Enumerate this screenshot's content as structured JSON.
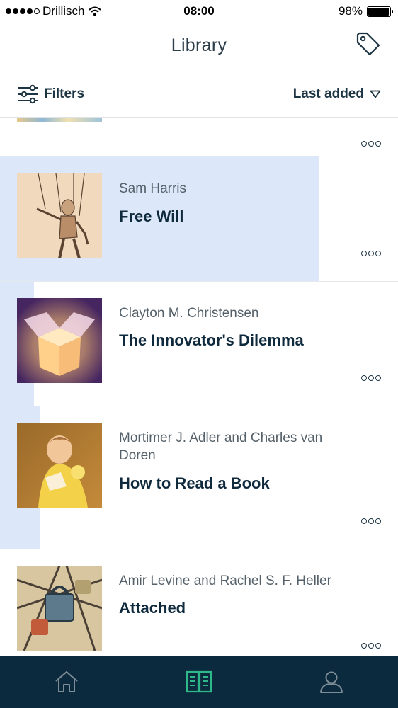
{
  "status_bar": {
    "carrier": "Drillisch",
    "time": "08:00",
    "battery": "98%",
    "battery_level": 0.98
  },
  "header": {
    "title": "Library",
    "tag_icon": "tag-icon"
  },
  "toolbar": {
    "filters_label": "Filters",
    "sort_label": "Last added"
  },
  "books": [
    {
      "author": "",
      "title": ""
    },
    {
      "author": "Sam Harris",
      "title": "Free Will"
    },
    {
      "author": "Clayton M. Christensen",
      "title": "The Innovator's Dilemma"
    },
    {
      "author": "Mortimer J. Adler and Charles van Doren",
      "title": "How to Read a Book"
    },
    {
      "author": "Amir Levine and Rachel S. F. Heller",
      "title": "Attached"
    }
  ],
  "tab_bar": {
    "tabs": [
      "home-icon",
      "library-icon",
      "profile-icon"
    ],
    "active": "library-icon"
  },
  "colors": {
    "accent": "#2fb88a",
    "tab_background": "#0c2a3d",
    "highlight": "#dce8f9"
  }
}
